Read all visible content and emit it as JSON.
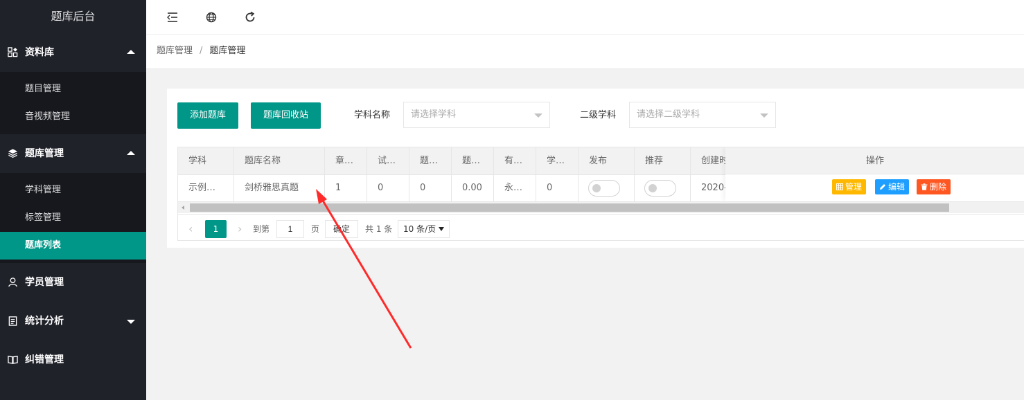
{
  "sidebar": {
    "title": "题库后台",
    "groups": [
      {
        "label": "资料库",
        "icon": "grid-icon",
        "items": [
          {
            "label": "题目管理"
          },
          {
            "label": "音视频管理"
          }
        ]
      },
      {
        "label": "题库管理",
        "icon": "layers-icon",
        "items": [
          {
            "label": "学科管理"
          },
          {
            "label": "标签管理"
          },
          {
            "label": "题库列表",
            "active": true
          }
        ]
      },
      {
        "label": "学员管理",
        "icon": "user-icon"
      },
      {
        "label": "统计分析",
        "icon": "clipboard-icon"
      },
      {
        "label": "纠错管理",
        "icon": "book-open-icon"
      }
    ]
  },
  "header": {
    "icons": [
      "menu-fold-icon",
      "globe-icon",
      "refresh-icon"
    ]
  },
  "breadcrumb": [
    "题库管理",
    "题库管理"
  ],
  "toolbar": {
    "add_label": "添加题库",
    "recycle_label": "题库回收站",
    "subject_label": "学科名称",
    "subject_placeholder": "请选择学科",
    "sub_subject_label": "二级学科",
    "sub_subject_placeholder": "请选择二级学科"
  },
  "table": {
    "headers": [
      "学科",
      "题库名称",
      "章…",
      "试…",
      "题…",
      "题…",
      "有…",
      "学…",
      "发布",
      "推荐",
      "创建时"
    ],
    "ops_header": "操作",
    "rows": [
      {
        "cells": [
          "示例…",
          "剑桥雅思真题",
          "1",
          "0",
          "0",
          "0.00",
          "永…",
          "0",
          "",
          "",
          "2020-"
        ],
        "publish": false,
        "recommend": false
      }
    ],
    "ops": [
      {
        "label": "管理",
        "color": "#ffb800",
        "icon": "table-icon"
      },
      {
        "label": "编辑",
        "color": "#1e9fff",
        "icon": "pencil-icon"
      },
      {
        "label": "删除",
        "color": "#ff5722",
        "icon": "trash-icon"
      }
    ]
  },
  "pager": {
    "current": "1",
    "goto_label": "到第",
    "page_input": "1",
    "page_label": "页",
    "confirm_label": "确定",
    "total": "共 1 条",
    "size": "10 条/页"
  },
  "colors": {
    "primary": "#009688",
    "sidebar_bg": "#20222a",
    "annotation_arrow": "#ff2a2a"
  }
}
